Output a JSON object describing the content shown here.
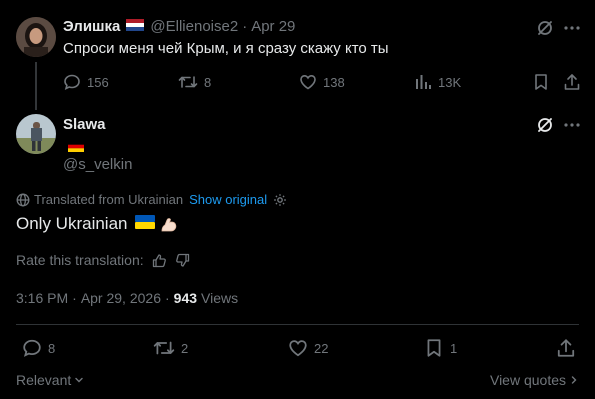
{
  "parent": {
    "display_name": "Элишка",
    "handle": "@Ellienoise2",
    "separator": "·",
    "date": "Apr 29",
    "text": "Спроси меня чей Крым, и я сразу скажу кто ты",
    "replies": "156",
    "reposts": "8",
    "likes": "138",
    "views": "13K"
  },
  "reply": {
    "display_name": "Slawa",
    "handle": "@s_velkin",
    "translated_from": "Translated from Ukrainian",
    "show_original": "Show original",
    "text": "Only Ukrainian",
    "rate_translation": "Rate this translation:",
    "time": "3:16 PM",
    "dot1": "·",
    "date": "Apr 29, 2026",
    "dot2": "·",
    "views_count": "943",
    "views_label": "Views",
    "replies": "8",
    "reposts": "2",
    "likes": "22",
    "bookmarks": "1"
  },
  "footer": {
    "sort_label": "Relevant",
    "view_quotes": "View quotes"
  },
  "colors": {
    "background": "#000000",
    "text": "#e7e9ea",
    "muted": "#71767b",
    "link": "#1d9bf0",
    "divider": "#2f3336"
  },
  "icons": [
    "reply-icon",
    "repost-icon",
    "like-icon",
    "views-icon",
    "bookmark-icon",
    "share-icon",
    "grok-icon",
    "more-icon",
    "globe-icon",
    "gear-icon",
    "thumbs-up-icon",
    "thumbs-down-icon",
    "chevron-down-icon",
    "chevron-right-icon",
    "netherlands-flag",
    "germany-flag",
    "ukraine-flag",
    "flexed-biceps-emoji"
  ]
}
